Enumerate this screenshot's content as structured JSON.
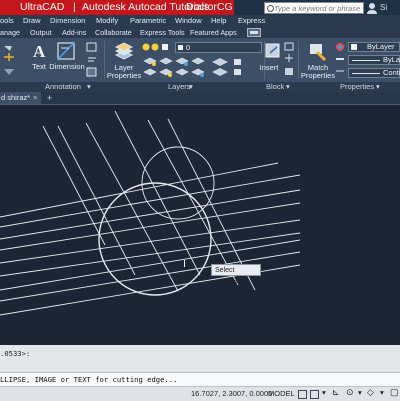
{
  "title_banner": {
    "part1": "UltraCAD",
    "sep": "|",
    "part2": "Autodesk Autocad Tutorials",
    "part3": "DoctorCG"
  },
  "search": {
    "placeholder": "Type a keyword or phrase"
  },
  "user": {
    "name": "Si"
  },
  "menu": [
    "ools",
    "Draw",
    "Dimension",
    "Modify",
    "Parametric",
    "Window",
    "Help",
    "Express"
  ],
  "ribbon_tabs": [
    "anage",
    "Output",
    "Add-ins",
    "Collaborate",
    "Express Tools",
    "Featured Apps"
  ],
  "ribbon": {
    "text_label": "Text",
    "dimension_label": "Dimension",
    "layer_properties_label": [
      "Layer",
      "Properties"
    ],
    "layer_combo_value": "0",
    "insert_label": "Insert",
    "match_properties_label": [
      "Match",
      "Properties"
    ],
    "bylayer_color": "ByLayer",
    "bylayer_linetype": "ByLayer",
    "continuous_label": "Conti"
  },
  "panels": {
    "annotation": "Annotation",
    "layers": "Layers",
    "block": "Block",
    "properties": "Properties"
  },
  "doc_tab": {
    "name": "d shiraz*"
  },
  "tooltip": {
    "text": "Select objects:"
  },
  "command": {
    "history": ".0533>:",
    "prompt": "LLIPSE, IMAGE or TEXT for cutting edge..."
  },
  "status": {
    "coords": "16.7027, 2.3007, 0.0000",
    "mode": "MODEL"
  },
  "colors": {
    "banner": "#c5171b",
    "titlebar": "#1f3144",
    "ribbon": "#3c4f66",
    "canvas": "#1c2535",
    "drawing_lines": "#ffffff"
  }
}
